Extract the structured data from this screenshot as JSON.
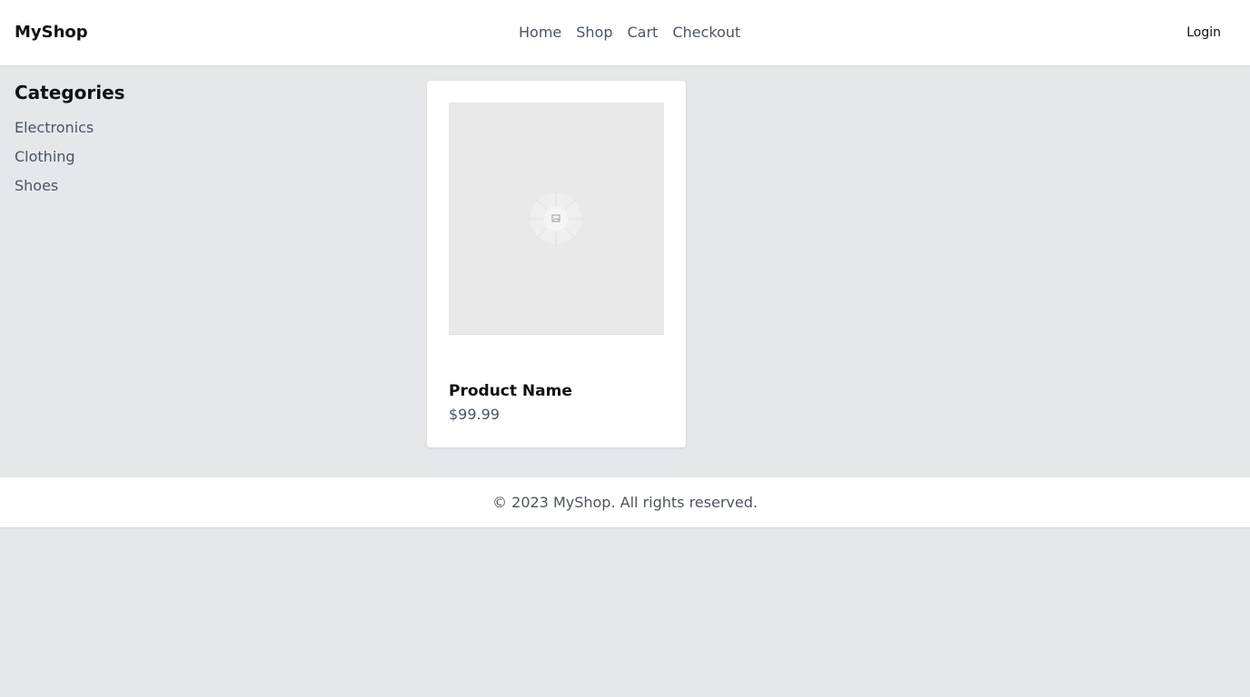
{
  "header": {
    "logo": "MyShop",
    "nav": [
      {
        "label": "Home"
      },
      {
        "label": "Shop"
      },
      {
        "label": "Cart"
      },
      {
        "label": "Checkout"
      }
    ],
    "login_label": "Login"
  },
  "sidebar": {
    "title": "Categories",
    "items": [
      {
        "label": "Electronics"
      },
      {
        "label": "Clothing"
      },
      {
        "label": "Shoes"
      }
    ]
  },
  "product": {
    "name": "Product Name",
    "price": "$99.99",
    "image_icon": "image-placeholder-icon"
  },
  "footer": {
    "text": "© 2023 MyShop. All rights reserved."
  },
  "colors": {
    "page_background": "#e5e7eb",
    "surface": "#ffffff",
    "text_primary": "#111111",
    "text_muted": "#4b5563"
  }
}
